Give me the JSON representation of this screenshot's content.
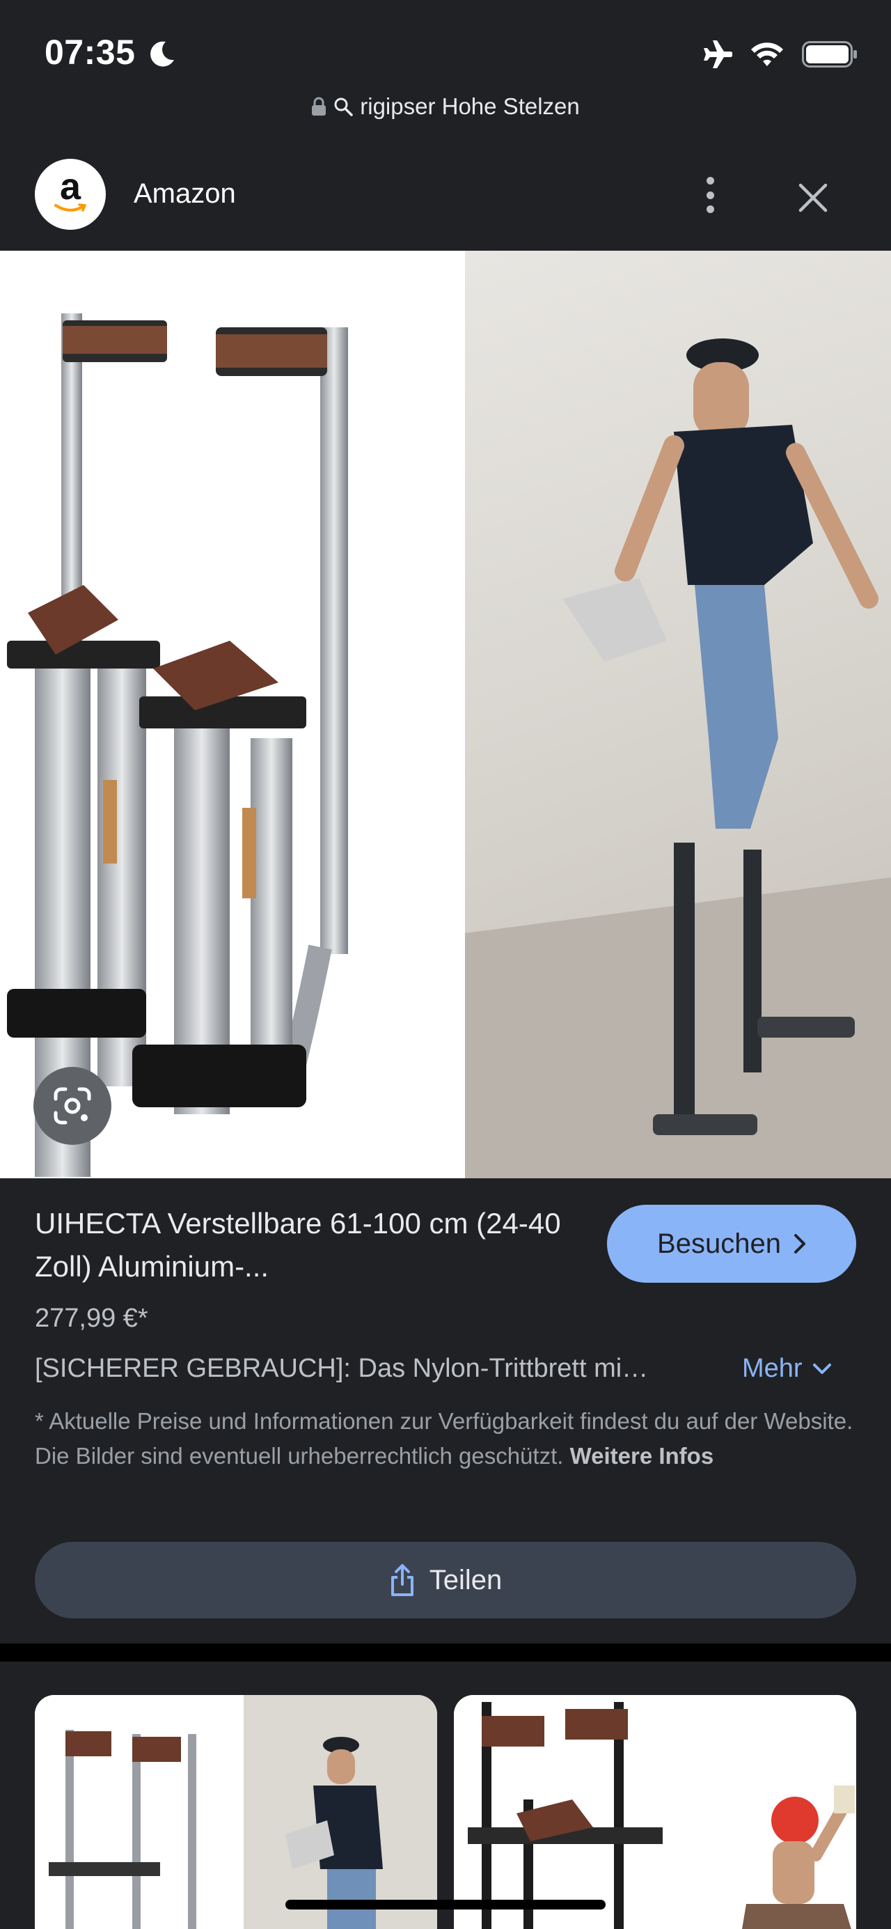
{
  "status_bar": {
    "time": "07:35",
    "icons": [
      "moon-icon",
      "airplane-icon",
      "wifi-icon",
      "battery-icon"
    ]
  },
  "url_bar": {
    "query": "rigipser Hohe Stelzen",
    "icons": [
      "lock-icon",
      "search-icon"
    ]
  },
  "header": {
    "source_name": "Amazon",
    "logo_letter": "a"
  },
  "result": {
    "title": "UIHECTA Verstellbare 61-100 cm (24-40 Zoll) Aluminium-...",
    "visit_label": "Besuchen",
    "price": "277,99 €*",
    "description": "[SICHERER GEBRAUCH]: Das Nylon-Trittbrett mi…",
    "more_label": "Mehr",
    "disclaimer": "* Aktuelle Preise und Informationen zur Verfügbarkeit findest du auf der Website. Die Bilder sind eventuell urheberrechtlich geschützt.",
    "disclaimer_link": "Weitere Infos",
    "share_label": "Teilen"
  },
  "colors": {
    "background": "#202124",
    "accent": "#8ab4f8",
    "share_button": "#3c4350"
  }
}
